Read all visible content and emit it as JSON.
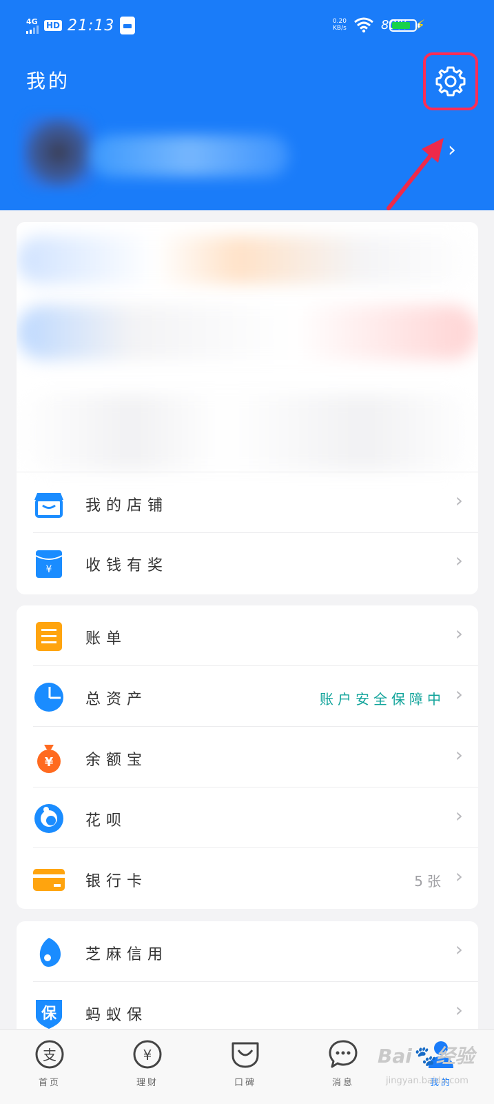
{
  "status_bar": {
    "network": "4G",
    "hd": "HD",
    "time": "21:13",
    "net_speed_value": "0.20",
    "net_speed_unit": "KB/s",
    "battery_percent": "80%",
    "battery_level": 0.8
  },
  "header": {
    "title": "我的"
  },
  "colors": {
    "primary": "#1a7cf9",
    "highlight_box": "#ff2d55",
    "arrow": "#ee2a4a",
    "detail_green": "#10a39a"
  },
  "section_store": {
    "items": [
      {
        "label": "我的店铺",
        "icon": "store-icon"
      },
      {
        "label": "收钱有奖",
        "icon": "red-envelope-icon"
      }
    ]
  },
  "section_finance": {
    "items": [
      {
        "label": "账单",
        "icon": "bill-icon",
        "detail": ""
      },
      {
        "label": "总资产",
        "icon": "pie-chart-icon",
        "detail": "账户安全保障中"
      },
      {
        "label": "余额宝",
        "icon": "money-bag-icon",
        "detail": ""
      },
      {
        "label": "花呗",
        "icon": "huabei-icon",
        "detail": ""
      },
      {
        "label": "银行卡",
        "icon": "bank-card-icon",
        "detail": "5张"
      }
    ]
  },
  "section_credit": {
    "items": [
      {
        "label": "芝麻信用",
        "icon": "sesame-credit-icon"
      },
      {
        "label": "蚂蚁保",
        "icon": "ant-insurance-icon",
        "icon_text": "保"
      }
    ]
  },
  "tabbar": {
    "tabs": [
      {
        "label": "首页",
        "icon": "alipay-home-icon",
        "icon_text": "支"
      },
      {
        "label": "理财",
        "icon": "wealth-icon",
        "icon_text": "¥"
      },
      {
        "label": "口碑",
        "icon": "koubei-icon"
      },
      {
        "label": "消息",
        "icon": "message-icon"
      },
      {
        "label": "我的",
        "icon": "profile-icon"
      }
    ]
  },
  "watermark": {
    "brand": "Bai🐾经验",
    "url": "jingyan.baidu.com"
  }
}
